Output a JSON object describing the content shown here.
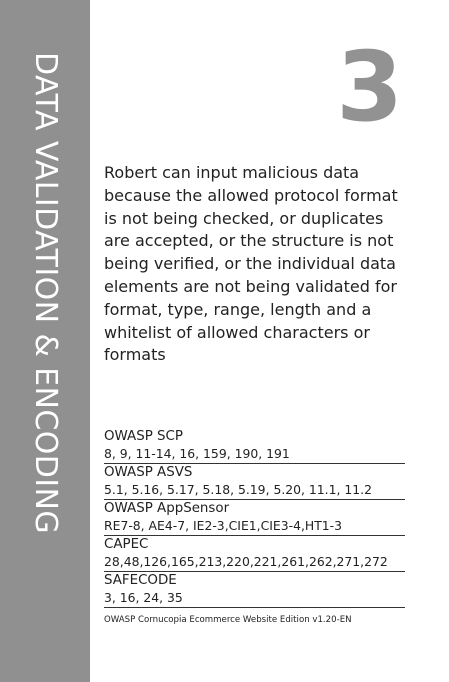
{
  "card": {
    "category": "DATA VALIDATION & ENCODING",
    "number": "3",
    "description": "Robert can input malicious data because the allowed protocol format is not being checked, or duplicates are accepted, or the structure is not being verified, or the individual data elements are not being validated for format, type, range, length and a whitelist of allowed characters or formats"
  },
  "references": [
    {
      "title": "OWASP SCP",
      "values": "8, 9, 11-14, 16, 159, 190, 191"
    },
    {
      "title": "OWASP ASVS",
      "values": "5.1, 5.16, 5.17, 5.18, 5.19, 5.20, 11.1, 11.2"
    },
    {
      "title": "OWASP AppSensor",
      "values": "RE7-8, AE4-7, IE2-3,CIE1,CIE3-4,HT1-3"
    },
    {
      "title": "CAPEC",
      "values": "28,48,126,165,213,220,221,261,262,271,272"
    },
    {
      "title": "SAFECODE",
      "values": "3, 16, 24, 35"
    }
  ],
  "footer": "OWASP Cornucopia Ecommerce Website Edition v1.20-EN",
  "colors": {
    "sidebar": "#909090",
    "number": "#929292",
    "text": "#222222",
    "background": "#ffffff"
  }
}
